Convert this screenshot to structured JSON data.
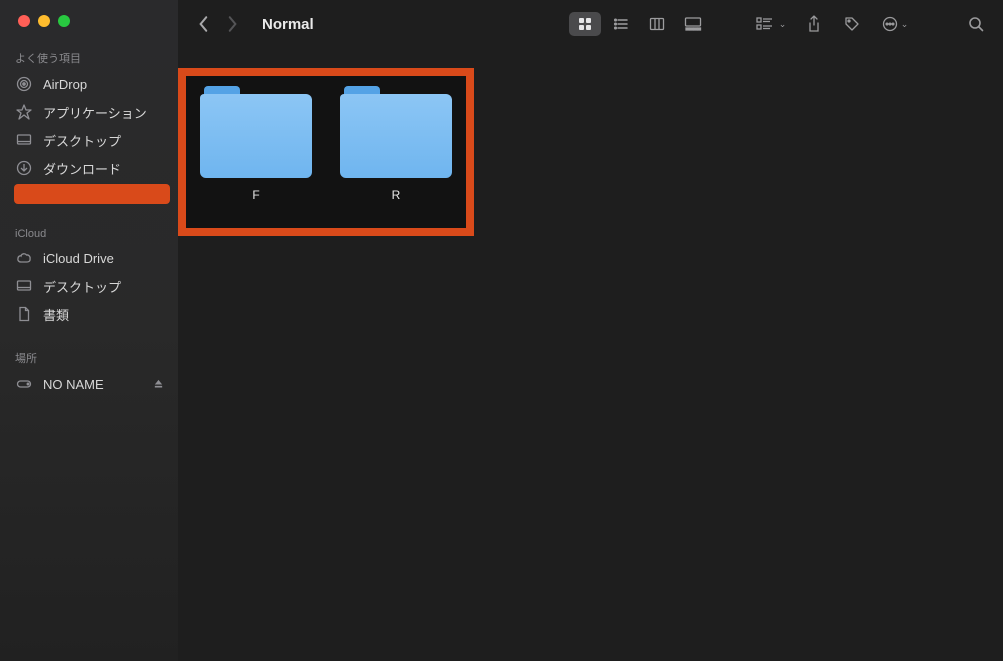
{
  "window": {
    "title": "Normal"
  },
  "sidebar": {
    "sections": [
      {
        "header": "よく使う項目",
        "items": [
          {
            "icon": "airdrop",
            "label": "AirDrop"
          },
          {
            "icon": "apps",
            "label": "アプリケーション"
          },
          {
            "icon": "desktop",
            "label": "デスクトップ"
          },
          {
            "icon": "download",
            "label": "ダウンロード"
          }
        ],
        "selected_extra": true
      },
      {
        "header": "iCloud",
        "items": [
          {
            "icon": "cloud",
            "label": "iCloud Drive"
          },
          {
            "icon": "desktop",
            "label": "デスクトップ"
          },
          {
            "icon": "doc",
            "label": "書類"
          }
        ]
      },
      {
        "header": "場所",
        "items": [
          {
            "icon": "disk",
            "label": "NO NAME",
            "eject": true
          }
        ]
      }
    ]
  },
  "content": {
    "folders": [
      {
        "name": "F"
      },
      {
        "name": "R"
      }
    ]
  }
}
